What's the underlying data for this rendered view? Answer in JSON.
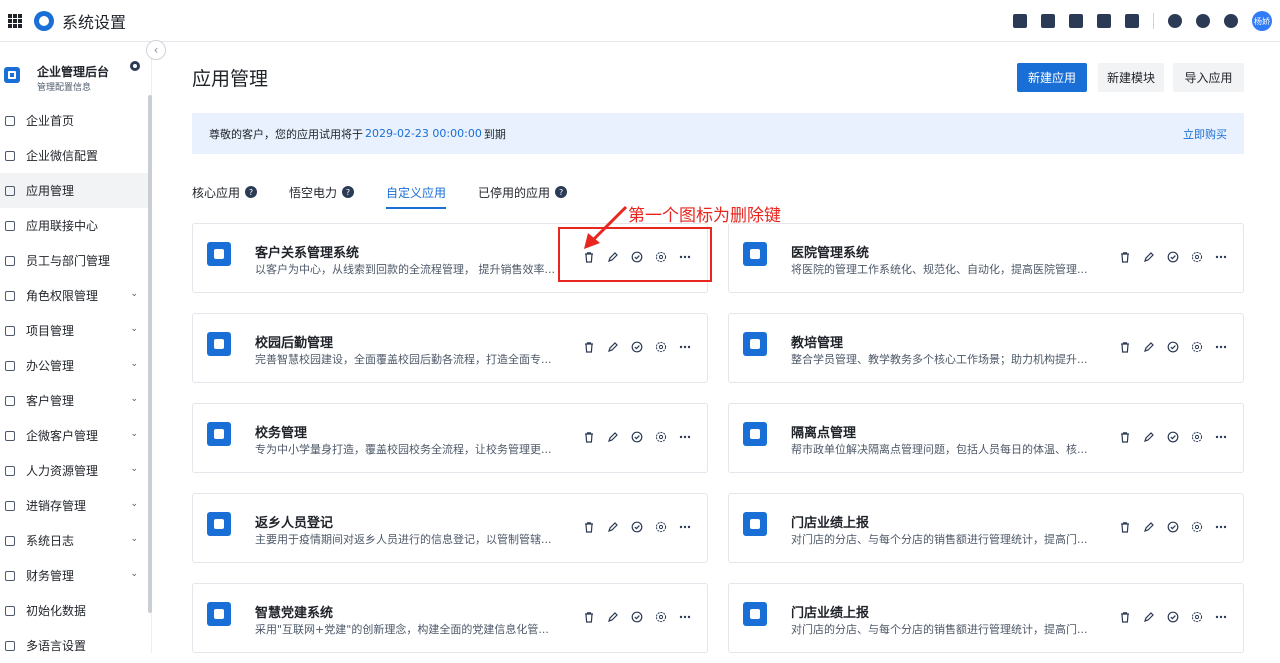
{
  "topbar": {
    "title": "系统设置",
    "avatar_text": "杨娇",
    "icons": [
      "grid-icon",
      "app-logo-icon",
      "check-square-icon",
      "person-icon",
      "note-icon",
      "phone-icon",
      "calendar-icon",
      "bell-icon",
      "help-icon",
      "gear-icon"
    ]
  },
  "org": {
    "name": "企业管理后台",
    "sub": "管理配置信息"
  },
  "nav": {
    "items": [
      {
        "label": "企业首页",
        "icon": "home-icon",
        "has_chevron": false
      },
      {
        "label": "企业微信配置",
        "icon": "search-icon",
        "has_chevron": false
      },
      {
        "label": "应用管理",
        "icon": "apps-icon",
        "has_chevron": false,
        "active": true
      },
      {
        "label": "应用联接中心",
        "icon": "location-icon",
        "has_chevron": false
      },
      {
        "label": "员工与部门管理",
        "icon": "users-icon",
        "has_chevron": false
      },
      {
        "label": "角色权限管理",
        "icon": "role-icon",
        "has_chevron": true
      },
      {
        "label": "项目管理",
        "icon": "folder-icon",
        "has_chevron": true
      },
      {
        "label": "办公管理",
        "icon": "briefcase-icon",
        "has_chevron": true
      },
      {
        "label": "客户管理",
        "icon": "contact-icon",
        "has_chevron": true
      },
      {
        "label": "企微客户管理",
        "icon": "wechat-icon",
        "has_chevron": true
      },
      {
        "label": "人力资源管理",
        "icon": "person-icon",
        "has_chevron": true
      },
      {
        "label": "进销存管理",
        "icon": "box-icon",
        "has_chevron": true
      },
      {
        "label": "系统日志",
        "icon": "log-icon",
        "has_chevron": true
      },
      {
        "label": "财务管理",
        "icon": "finance-icon",
        "has_chevron": true
      },
      {
        "label": "初始化数据",
        "icon": "triangle-icon",
        "has_chevron": false
      },
      {
        "label": "多语言设置",
        "icon": "language-icon",
        "has_chevron": false
      }
    ]
  },
  "main": {
    "title": "应用管理",
    "buttons": {
      "new_app": "新建应用",
      "new_module": "新建模块",
      "import_app": "导入应用"
    },
    "notice": {
      "prefix": "尊敬的客户，您的应用试用将于",
      "date": "2029-02-23 00:00:00",
      "suffix": "到期",
      "buy": "立即购买"
    },
    "tabs": [
      {
        "label": "核心应用",
        "help": true
      },
      {
        "label": "悟空电力",
        "help": true
      },
      {
        "label": "自定义应用",
        "help": false,
        "active": true
      },
      {
        "label": "已停用的应用",
        "help": true
      }
    ],
    "cards": [
      {
        "title": "客户关系管理系统",
        "desc": "以客户为中心，从线索到回款的全流程管理， 提升销售效率...",
        "icon": "user-icon"
      },
      {
        "title": "医院管理系统",
        "desc": "将医院的管理工作系统化、规范化、自动化，提高医院管理...",
        "icon": "medical-kit-icon"
      },
      {
        "title": "校园后勤管理",
        "desc": "完善智慧校园建设，全面覆盖校园后勤各流程，打造全面专...",
        "icon": "school-icon"
      },
      {
        "title": "教培管理",
        "desc": "整合学员管理、教学教务多个核心工作场景；助力机构提升...",
        "icon": "tie-icon"
      },
      {
        "title": "校务管理",
        "desc": "专为中小学量身打造，覆盖校园校务全流程，让校务管理更...",
        "icon": "graduation-cap-icon"
      },
      {
        "title": "隔离点管理",
        "desc": "帮市政单位解决隔离点管理问题，包括人员每日的体温、核...",
        "icon": "shield-icon"
      },
      {
        "title": "返乡人员登记",
        "desc": "主要用于疫情期间对返乡人员进行的信息登记，以管制管辖...",
        "icon": "clipboard-icon"
      },
      {
        "title": "门店业绩上报",
        "desc": "对门店的分店、与每个分店的销售额进行管理统计，提高门...",
        "icon": "store-icon"
      },
      {
        "title": "智慧党建系统",
        "desc": "采用\"互联网+党建\"的创新理念，构建全面的党建信息化管...",
        "icon": "chart-icon"
      },
      {
        "title": "门店业绩上报",
        "desc": "对门店的分店、与每个分店的销售额进行管理统计，提高门...",
        "icon": "store-icon"
      }
    ],
    "card_actions": [
      "trash-icon",
      "edit-icon",
      "shield-check-icon",
      "settings-icon",
      "more-icon"
    ]
  },
  "annotation": {
    "text": "第一个图标为删除键",
    "color": "#e8251e"
  },
  "colors": {
    "primary": "#1a6fd6",
    "notice_bg": "#e8f1fd",
    "annotation": "#e8251e"
  }
}
